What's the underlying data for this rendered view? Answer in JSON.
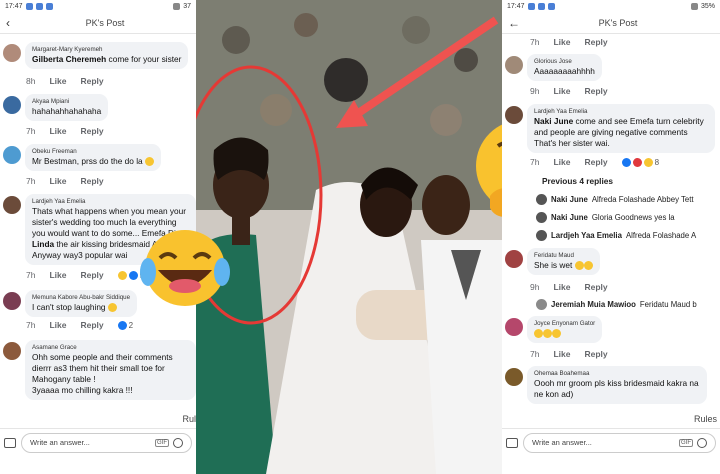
{
  "left": {
    "status_time": "17:47",
    "status_battery": "37",
    "title": "PK's Post",
    "comments": [
      {
        "name": "Margaret-Mary Kyeremeh",
        "tag": "Gilberta Cheremeh",
        "text": " come for your sister",
        "time": "8h",
        "like": "Like",
        "reply": "Reply"
      },
      {
        "name": "Akyaa Mpiani",
        "tag": "",
        "text": "hahahahhahahaha",
        "time": "7h",
        "like": "Like",
        "reply": "Reply"
      },
      {
        "name": "Obeku Freeman",
        "tag": "",
        "text": "Mr Bestman, prss do the do la",
        "time": "7h",
        "like": "Like",
        "reply": "Reply"
      },
      {
        "name": "Lardjeh Yaa Emelia",
        "tag": "",
        "text": "Thats what happens when you mean your sister's wedding too much la  everything you would want to do some... Emefa Di",
        "tag2": "Linda",
        "text2": " the air kissing bridesmaid A",
        "text3": "Anyway way3 popular wai",
        "time": "7h",
        "like": "Like",
        "reply": "Reply",
        "count": "5"
      },
      {
        "name": "Memuna Kabore Abu-bakr Siddique",
        "tag": "",
        "text": "I can't stop laughing",
        "time": "7h",
        "like": "Like",
        "reply": "Reply",
        "count": "2"
      },
      {
        "name": "Asamane Grace",
        "tag": "",
        "text": "Ohh some people and their comments dierrr as3 them hit their small toe for Mahogany table !",
        "text3": "3yaaaa mo chilling kakra !!!",
        "time": "",
        "like": "",
        "reply": ""
      }
    ],
    "rules": "Rul",
    "composer_placeholder": "Write an answer...",
    "gif": "GIF"
  },
  "right": {
    "status_time": "17:47",
    "status_battery": "35%",
    "title": "PK's Post",
    "top_meta": {
      "time": "7h",
      "like": "Like",
      "reply": "Reply"
    },
    "comments": [
      {
        "name": "Glorious Jose",
        "text": "Aaaaaaaaahhhh",
        "time": "9h",
        "like": "Like",
        "reply": "Reply"
      },
      {
        "name": "Lardjeh Yaa Emelia",
        "tag": "Naki June",
        "text": " come and see Emefa turn celebrity and people are giving negative comments  That's her sister wai.",
        "time": "7h",
        "like": "Like",
        "reply": "Reply",
        "count": "8"
      },
      {
        "name": "Feridatu Maud",
        "text": "She is wet",
        "time": "9h",
        "like": "Like",
        "reply": "Reply"
      },
      {
        "name": "Joyce Enyonam Gator",
        "text": "",
        "time": "7h",
        "like": "Like",
        "reply": "Reply"
      },
      {
        "name": "Ohemaa Boahemaa",
        "text": "Oooh mr groom pls kiss bridesmaid kakra na ne kon ad)",
        "time": "",
        "like": "",
        "reply": ""
      }
    ],
    "previous_replies": "Previous 4 replies",
    "replies": [
      {
        "name": "Naki June",
        "text": "Alfreda Folashade Abbey Tett"
      },
      {
        "name": "Naki June",
        "text": "Gloria Goodnews yes la"
      },
      {
        "name": "Lardjeh Yaa Emelia",
        "text": "Alfreda Folashade A"
      }
    ],
    "reply2": {
      "name": "Jeremiah Muia Mawioo",
      "text": "Feridatu Maud b"
    },
    "rules": "Rules",
    "composer_placeholder": "Write an answer...",
    "gif": "GIF"
  },
  "colors": {
    "accent": "#1877f2",
    "bubble": "#f0f2f5",
    "meta": "#65676b",
    "circle": "#e53935"
  }
}
